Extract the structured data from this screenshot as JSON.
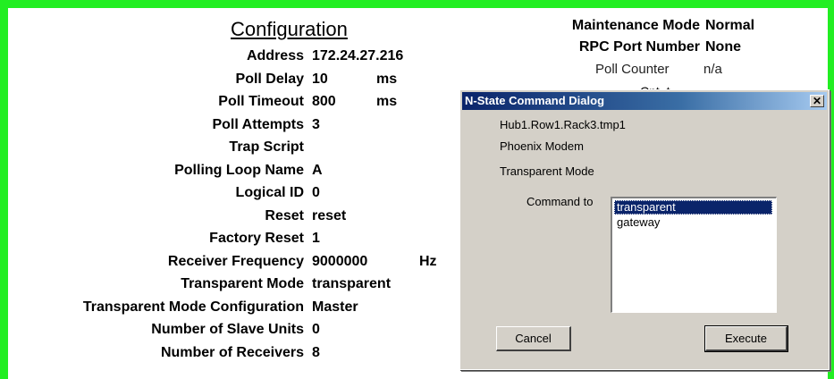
{
  "config": {
    "title": "Configuration",
    "rows": [
      {
        "label": "Address",
        "value": "172.24.27.216",
        "unit": ""
      },
      {
        "label": "Poll Delay",
        "value": "10",
        "unit": "ms"
      },
      {
        "label": "Poll Timeout",
        "value": "800",
        "unit": "ms"
      },
      {
        "label": "Poll Attempts",
        "value": "3",
        "unit": ""
      },
      {
        "label": "Trap Script",
        "value": "",
        "unit": ""
      },
      {
        "label": "Polling Loop Name",
        "value": "A",
        "unit": ""
      },
      {
        "label": "Logical ID",
        "value": "0",
        "unit": ""
      },
      {
        "label": "Reset",
        "value": "reset",
        "unit": ""
      },
      {
        "label": "Factory Reset",
        "value": "1",
        "unit": ""
      },
      {
        "label": "Receiver Frequency",
        "value": "9000000",
        "unit": "Hz"
      },
      {
        "label": "Transparent Mode",
        "value": "transparent",
        "unit": ""
      },
      {
        "label": "Transparent Mode Configuration",
        "value": "Master",
        "unit": ""
      },
      {
        "label": "Number of Slave Units",
        "value": "0",
        "unit": ""
      },
      {
        "label": "Number of Receivers",
        "value": "8",
        "unit": ""
      }
    ]
  },
  "right_panel": {
    "maintenance_label": "Maintenance Mode",
    "maintenance_value": "Normal",
    "rpc_label": "RPC Port Number",
    "rpc_value": "None",
    "poll_counter_label": "Poll Counter",
    "poll_counter_value": "n/a",
    "partial_text": "Cnt..t"
  },
  "dialog": {
    "title": "N-State Command Dialog",
    "close_glyph": "✕",
    "device_path": "Hub1.Row1.Rack3.tmp1",
    "device_type": "Phoenix Modem",
    "mode_label": "Transparent Mode",
    "command_label": "Command to",
    "options": [
      "transparent",
      "gateway"
    ],
    "selected_option": "transparent",
    "cancel_label": "Cancel",
    "execute_label": "Execute"
  },
  "colors": {
    "frame": "#22ee22",
    "dialog_bg": "#d4d0c8",
    "titlebar": "#0a246a",
    "selection": "#0a246a"
  }
}
